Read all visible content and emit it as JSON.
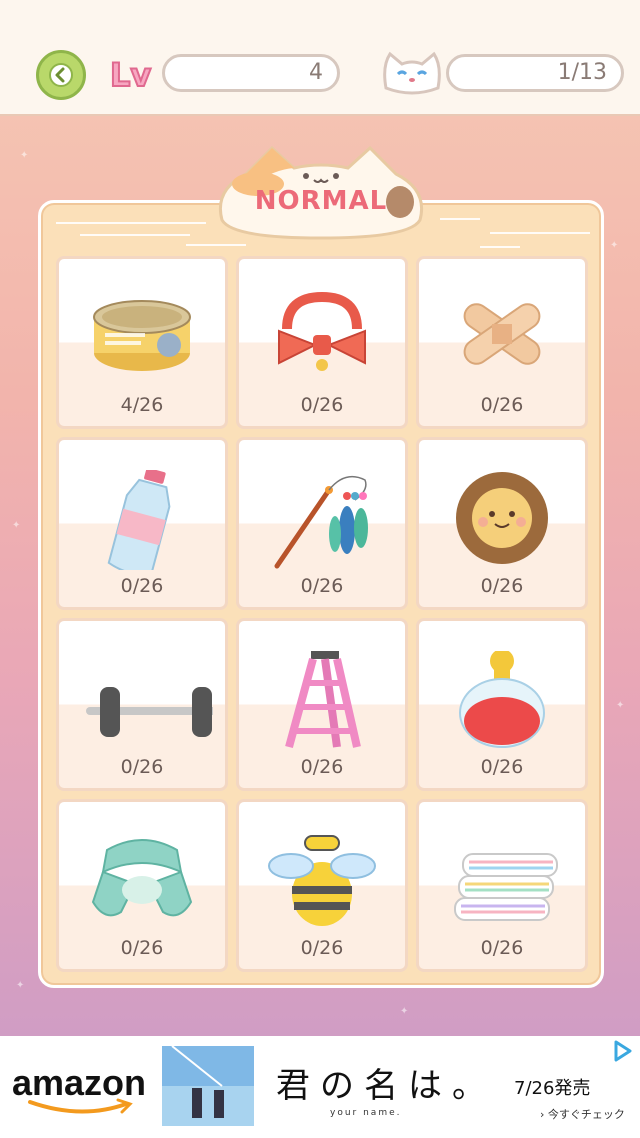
{
  "header": {
    "level": "4",
    "cats_collected": "1/13"
  },
  "section": {
    "title": "NORMAL"
  },
  "items": [
    {
      "name": "cat-food-can",
      "count": "4/26"
    },
    {
      "name": "red-bow-collar",
      "count": "0/26"
    },
    {
      "name": "bandage-cross",
      "count": "0/26"
    },
    {
      "name": "water-bottle",
      "count": "0/26"
    },
    {
      "name": "feather-teaser-wand",
      "count": "0/26"
    },
    {
      "name": "lion-mane-cushion",
      "count": "0/26"
    },
    {
      "name": "dumbbell",
      "count": "0/26"
    },
    {
      "name": "pink-stepladder",
      "count": "0/26"
    },
    {
      "name": "perfume-bottle",
      "count": "0/26"
    },
    {
      "name": "mint-scarf",
      "count": "0/26"
    },
    {
      "name": "bee-costume",
      "count": "0/26"
    },
    {
      "name": "striped-towels",
      "count": "0/26"
    }
  ],
  "ad": {
    "brand": "amazon",
    "movie_title": "君の名は。",
    "movie_subtitle": "your name.",
    "release": "7/26発売",
    "cta": "› 今すぐチェック"
  },
  "colors": {
    "accent": "#ec6a78",
    "panel": "#fbe0b9",
    "back_button": "#b9d86a"
  }
}
